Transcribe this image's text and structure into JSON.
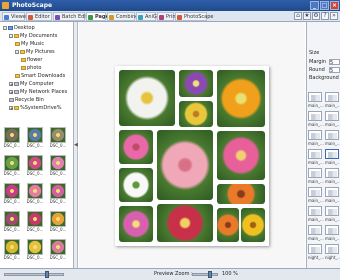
{
  "window": {
    "title": "PhotoScape"
  },
  "tabs": [
    {
      "label": "Viewer",
      "color": "#4b7bd0"
    },
    {
      "label": "Editor",
      "color": "#d25a3a"
    },
    {
      "label": "Batch Editor",
      "color": "#7a4fb4"
    },
    {
      "label": "Page",
      "color": "#3a9a48"
    },
    {
      "label": "Combine",
      "color": "#d49a28"
    },
    {
      "label": "AniGif",
      "color": "#3aa0c0"
    },
    {
      "label": "Print",
      "color": "#b0407c"
    },
    {
      "label": "PhotoScape",
      "color": "#d25a3a"
    }
  ],
  "active_tab": "Page",
  "tree": [
    {
      "label": "Desktop",
      "indent": 0,
      "kind": "blue",
      "exp": "-"
    },
    {
      "label": "My Documents",
      "indent": 1,
      "kind": "yellow",
      "exp": "-"
    },
    {
      "label": "My Music",
      "indent": 2,
      "kind": "yellow",
      "exp": ""
    },
    {
      "label": "My Pictures",
      "indent": 2,
      "kind": "yellow",
      "exp": "-"
    },
    {
      "label": "flower",
      "indent": 3,
      "kind": "yellow",
      "exp": ""
    },
    {
      "label": "photo",
      "indent": 3,
      "kind": "yellow",
      "exp": ""
    },
    {
      "label": "Smart Downloads",
      "indent": 2,
      "kind": "yellow",
      "exp": ""
    },
    {
      "label": "My Computer",
      "indent": 1,
      "kind": "gray",
      "exp": "+"
    },
    {
      "label": "My Network Places",
      "indent": 1,
      "kind": "gray",
      "exp": "+"
    },
    {
      "label": "Recycle Bin",
      "indent": 1,
      "kind": "gray",
      "exp": ""
    },
    {
      "label": "%SystemDrive%",
      "indent": 1,
      "kind": "yellow",
      "exp": "+"
    }
  ],
  "thumbnails": [
    {
      "caption": "DSC_0...",
      "color": "#7a6e5a"
    },
    {
      "caption": "DSC_0...",
      "color": "#5a7aa8"
    },
    {
      "caption": "DSC_0...",
      "color": "#9a8a70"
    },
    {
      "caption": "DSC_0...",
      "color": "#6aa04a"
    },
    {
      "caption": "DSC_0...",
      "color": "#d04a8a"
    },
    {
      "caption": "DSC_0...",
      "color": "#e080b0"
    },
    {
      "caption": "DSC_0...",
      "color": "#c83a8a"
    },
    {
      "caption": "DSC_0...",
      "color": "#e87aa8"
    },
    {
      "caption": "DSC_0...",
      "color": "#d060a0"
    },
    {
      "caption": "DSC_0...",
      "color": "#a04a70"
    },
    {
      "caption": "DSC_0...",
      "color": "#c8386a"
    },
    {
      "caption": "DSC_0...",
      "color": "#e8a03a"
    },
    {
      "caption": "DSC_0...",
      "color": "#d8b830"
    },
    {
      "caption": "DSC_0...",
      "color": "#e8c040"
    },
    {
      "caption": "DSC_0...",
      "color": "#d87a9a"
    }
  ],
  "collage_cells": [
    {
      "name": "white-daisy",
      "color": "#f2f2ee",
      "center": "#e8c23a"
    },
    {
      "name": "purple-flower",
      "color": "#8a4ab0",
      "center": "#f0e080"
    },
    {
      "name": "yellow-flower",
      "color": "#e8c83a",
      "center": "#c07a20"
    },
    {
      "name": "orange-flower-large",
      "color": "#f0a01a",
      "center": "#e8e070"
    },
    {
      "name": "pink-gerbera",
      "color": "#e868a8",
      "center": "#c04a6a"
    },
    {
      "name": "pink-blossom-branch",
      "color": "#f0a8b8",
      "center": "#d87088"
    },
    {
      "name": "pink-chrysanthemum",
      "color": "#e8609a",
      "center": "#f0d070"
    },
    {
      "name": "white-calla",
      "color": "#f8f8f8",
      "center": "#5a9a3a"
    },
    {
      "name": "orange-gerbera",
      "color": "#e87a2a",
      "center": "#8a3a1a"
    },
    {
      "name": "pink-cosmos",
      "color": "#d860b0",
      "center": "#f0e070"
    },
    {
      "name": "red-flower",
      "color": "#c8304a",
      "center": "#f0d060"
    }
  ],
  "right_panel": {
    "size_label": "Size",
    "margin_label": "Margin",
    "margin_value": "5",
    "round_label": "Round",
    "round_value": "5",
    "background_label": "Background",
    "presets": [
      {
        "caption": "main_..."
      },
      {
        "caption": "main_..."
      },
      {
        "caption": "main_..."
      },
      {
        "caption": "main_..."
      },
      {
        "caption": "main_..."
      },
      {
        "caption": "main_..."
      },
      {
        "caption": "main_..."
      },
      {
        "caption": "main_..."
      },
      {
        "caption": "main_..."
      },
      {
        "caption": "main_..."
      },
      {
        "caption": "main_..."
      },
      {
        "caption": "main_..."
      },
      {
        "caption": "main_..."
      },
      {
        "caption": "main_..."
      },
      {
        "caption": "main_..."
      },
      {
        "caption": "main_..."
      },
      {
        "caption": "night_..."
      },
      {
        "caption": "night_..."
      }
    ]
  },
  "status": {
    "preview_zoom_label": "Preview Zoom :",
    "zoom_value": "100 %",
    "zoom_level": 0.7
  }
}
